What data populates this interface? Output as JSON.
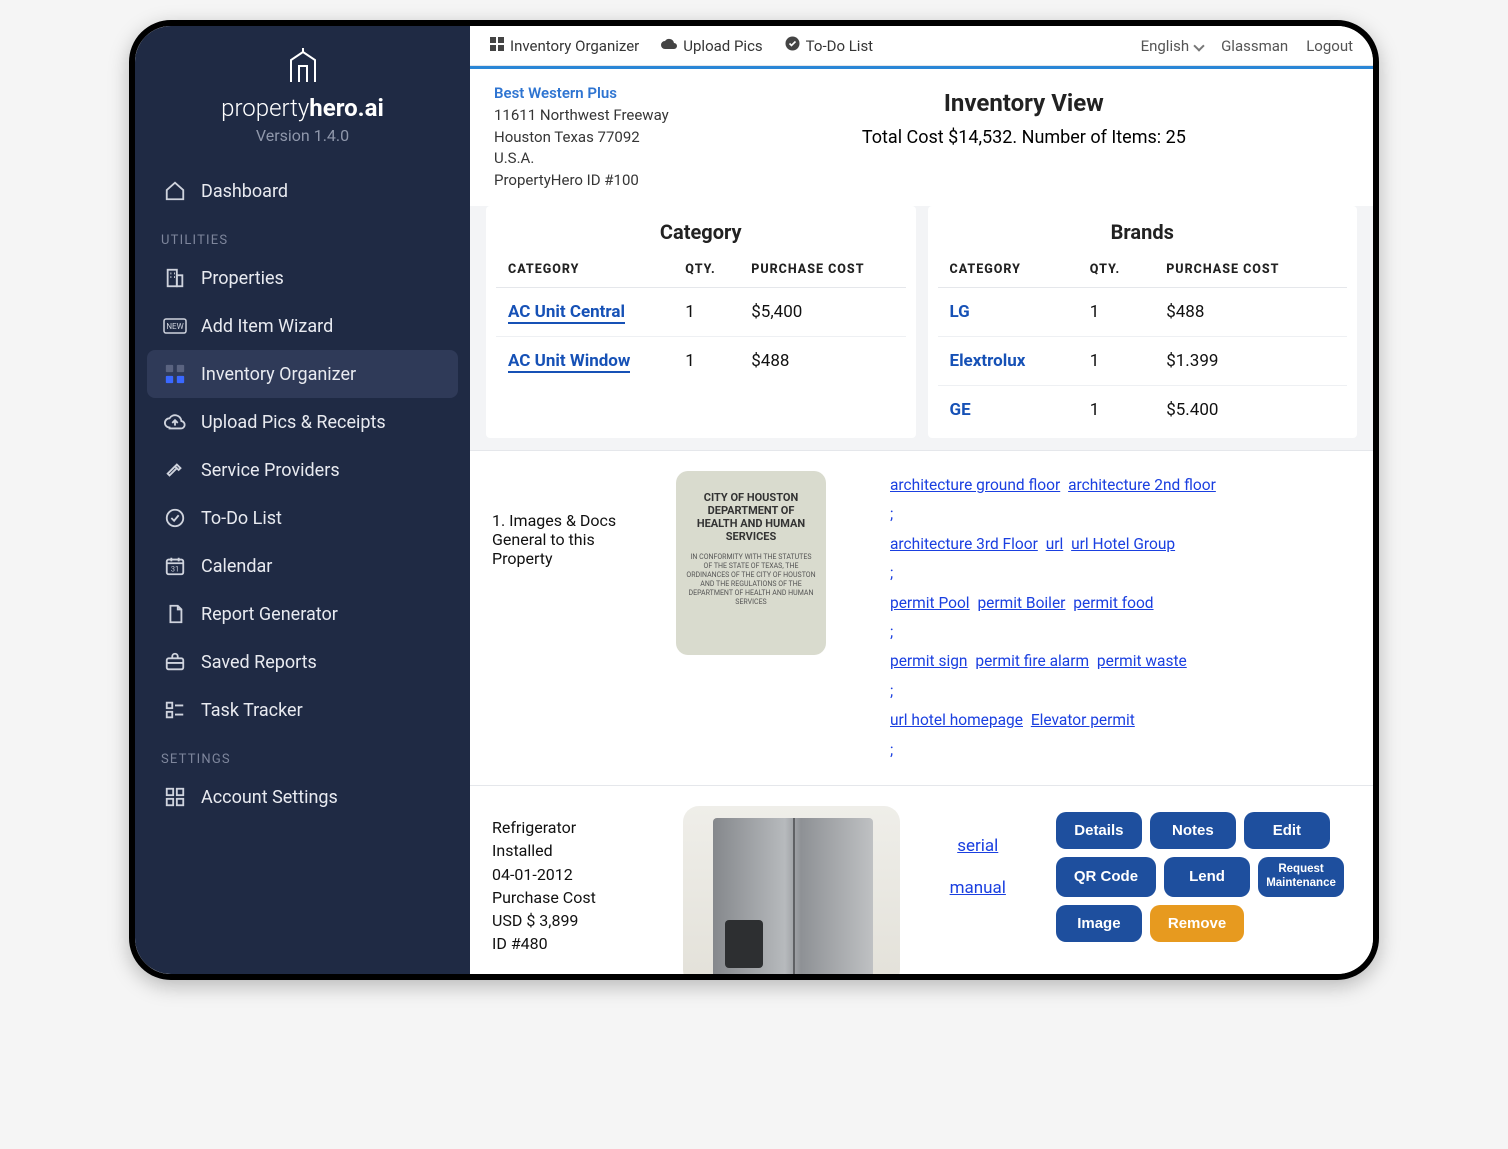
{
  "brand": {
    "part1": "property",
    "part2": "hero.ai",
    "version": "Version 1.4.0"
  },
  "nav": {
    "dashboard": "Dashboard",
    "section_utilities": "UTILITIES",
    "properties": "Properties",
    "add_item": "Add Item Wizard",
    "inventory": "Inventory Organizer",
    "upload": "Upload Pics & Receipts",
    "service": "Service Providers",
    "todo": "To-Do List",
    "calendar": "Calendar",
    "report_gen": "Report Generator",
    "saved_reports": "Saved Reports",
    "task_tracker": "Task Tracker",
    "section_settings": "SETTINGS",
    "account": "Account Settings"
  },
  "topbar": {
    "inventory": "Inventory Organizer",
    "upload": "Upload Pics",
    "todo": "To-Do List",
    "language": "English",
    "user": "Glassman",
    "logout": "Logout"
  },
  "property": {
    "name": "Best Western Plus",
    "addr1": "11611 Northwest Freeway",
    "addr2": "Houston Texas 77092",
    "country": "U.S.A.",
    "idline": "PropertyHero ID #100"
  },
  "header": {
    "title": "Inventory View",
    "subline": "Total Cost $14,532.  Number of Items: 25"
  },
  "category_panel": {
    "title": "Category",
    "cols": {
      "c1": "CATEGORY",
      "c2": "QTY.",
      "c3": "PURCHASE COST"
    },
    "rows": [
      {
        "name": "AC Unit Central",
        "qty": "1",
        "cost": "$5,400"
      },
      {
        "name": "AC Unit Window",
        "qty": "1",
        "cost": "$488"
      }
    ]
  },
  "brands_panel": {
    "title": "Brands",
    "cols": {
      "c1": "CATEGORY",
      "c2": "QTY.",
      "c3": "PURCHASE COST"
    },
    "rows": [
      {
        "name": "LG",
        "qty": "1",
        "cost": "$488"
      },
      {
        "name": "Elextrolux",
        "qty": "1",
        "cost": "$1.399"
      },
      {
        "name": "GE",
        "qty": "1",
        "cost": "$5.400"
      }
    ]
  },
  "docs": {
    "label": "1. Images & Docs General to this Property",
    "thumb_title": "CITY OF HOUSTON DEPARTMENT OF HEALTH AND HUMAN SERVICES",
    "links": {
      "l0": "architecture ground floor",
      "l1": "architecture 2nd floor",
      "l2": "architecture 3rd Floor",
      "l3": "url",
      "l4": "url Hotel Group",
      "l5": "permit Pool",
      "l6": "permit Boiler",
      "l7": "permit food",
      "l8": "permit sign",
      "l9": "permit fire alarm",
      "l10": "permit waste",
      "l11": "url hotel homepage",
      "l12": "Elevator permit"
    },
    "sep": ";"
  },
  "item": {
    "l1": "Refrigerator",
    "l2": "Installed",
    "l3": "04-01-2012",
    "l4": "Purchase Cost",
    "l5": "USD $ 3,899",
    "l6": "ID #480",
    "lnk_serial": "serial",
    "lnk_manual": "manual",
    "btn_details": "Details",
    "btn_notes": "Notes",
    "btn_edit": "Edit",
    "btn_qr": "QR Code",
    "btn_lend": "Lend",
    "btn_reqmaint1": "Request",
    "btn_reqmaint2": "Maintenance",
    "btn_image": "Image",
    "btn_remove": "Remove"
  }
}
